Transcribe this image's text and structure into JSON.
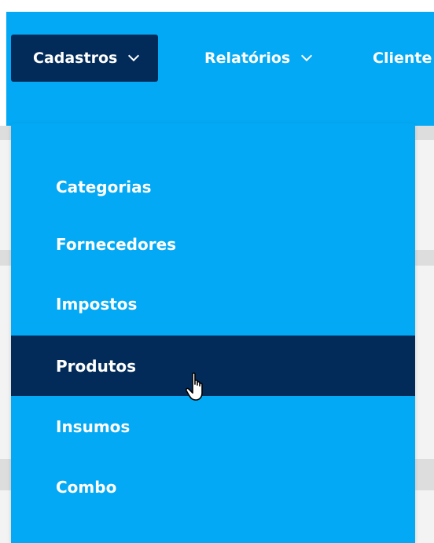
{
  "nav": {
    "items": [
      {
        "label": "Cadastros"
      },
      {
        "label": "Relatórios"
      },
      {
        "label": "Cliente"
      }
    ]
  },
  "dropdown": {
    "items": [
      {
        "label": "Categorias"
      },
      {
        "label": "Fornecedores"
      },
      {
        "label": "Impostos"
      },
      {
        "label": "Produtos"
      },
      {
        "label": "Insumos"
      },
      {
        "label": "Combo"
      }
    ],
    "hovered": "Produtos"
  },
  "colors": {
    "nav_bg": "#03a9f4",
    "active_bg": "#032b5a",
    "text": "#ffffff"
  },
  "icons": {
    "chevron": "chevron-down-icon",
    "cursor": "hand-pointer-icon"
  }
}
